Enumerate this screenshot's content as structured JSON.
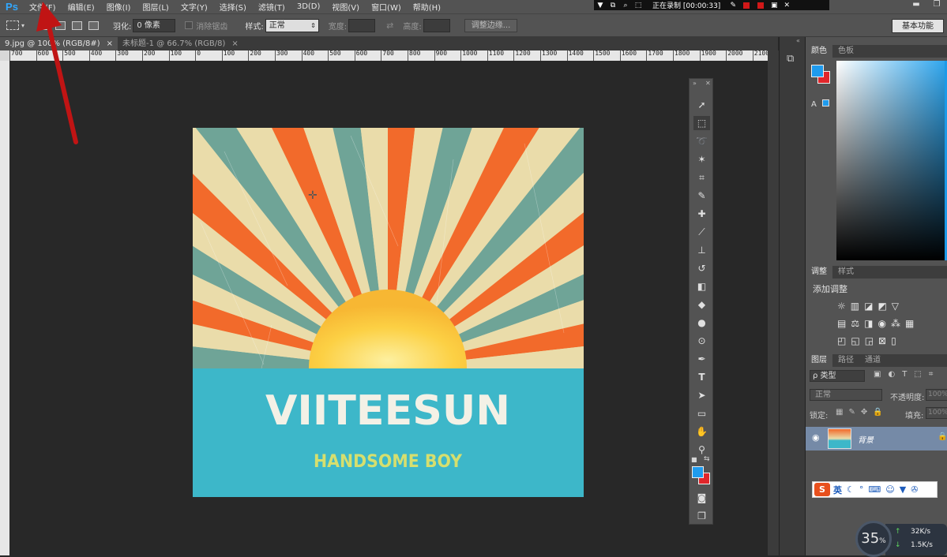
{
  "app": {
    "logo": "Ps"
  },
  "menu": [
    "文件(F)",
    "编辑(E)",
    "图像(I)",
    "图层(L)",
    "文字(Y)",
    "选择(S)",
    "滤镜(T)",
    "3D(D)",
    "视图(V)",
    "窗口(W)",
    "帮助(H)"
  ],
  "recording": {
    "status": "正在录制 [00:00:33]"
  },
  "options": {
    "feather_label": "羽化:",
    "feather_value": "0 像素",
    "antialias_label": "消除锯齿",
    "style_label": "样式:",
    "style_value": "正常",
    "width_label": "宽度:",
    "height_label": "高度:",
    "refine_edge": "调整边缘...",
    "workspace": "基本功能"
  },
  "tabs": [
    {
      "label": "9.jpg @ 100% (RGB/8#)",
      "close": "×"
    },
    {
      "label": "未标题-1 @ 66.7% (RGB/8)",
      "close": "×"
    }
  ],
  "ruler_labels": [
    "700",
    "600",
    "500",
    "400",
    "300",
    "200",
    "100",
    "0",
    "100",
    "200",
    "300",
    "400",
    "500",
    "600",
    "700",
    "800",
    "900",
    "1000",
    "1100",
    "1200",
    "1300",
    "1400",
    "1500",
    "1600",
    "1700",
    "1800",
    "1900",
    "2000",
    "2100"
  ],
  "artwork": {
    "title": "VIITEESUN",
    "subtitle": "HANDSOME BOY"
  },
  "colors": {
    "fg": "#1f9bee",
    "bg": "#e0262b",
    "orange": "#f26a2b",
    "teal": "#6fa497",
    "cream": "#eadcaa",
    "sea": "#3db7c9",
    "sun": "#fcd044"
  },
  "panels": {
    "color_tabs": [
      "颜色",
      "色板"
    ],
    "adjust_tabs": [
      "调整",
      "样式"
    ],
    "adjust_add": "添加调整",
    "layer_tabs": [
      "图层",
      "路径",
      "通道"
    ],
    "kind_filter": "ρ 类型",
    "blend_mode": "正常",
    "opacity_label": "不透明度:",
    "opacity_value": "100%",
    "lock_label": "锁定:",
    "fill_label": "填充:",
    "fill_value": "100%",
    "layer_name": "背景"
  },
  "ime": {
    "logo": "S",
    "lang": "英"
  },
  "network": {
    "percent": "35",
    "percent_unit": "%",
    "up": "32K/s",
    "down": "1.5K/s"
  }
}
